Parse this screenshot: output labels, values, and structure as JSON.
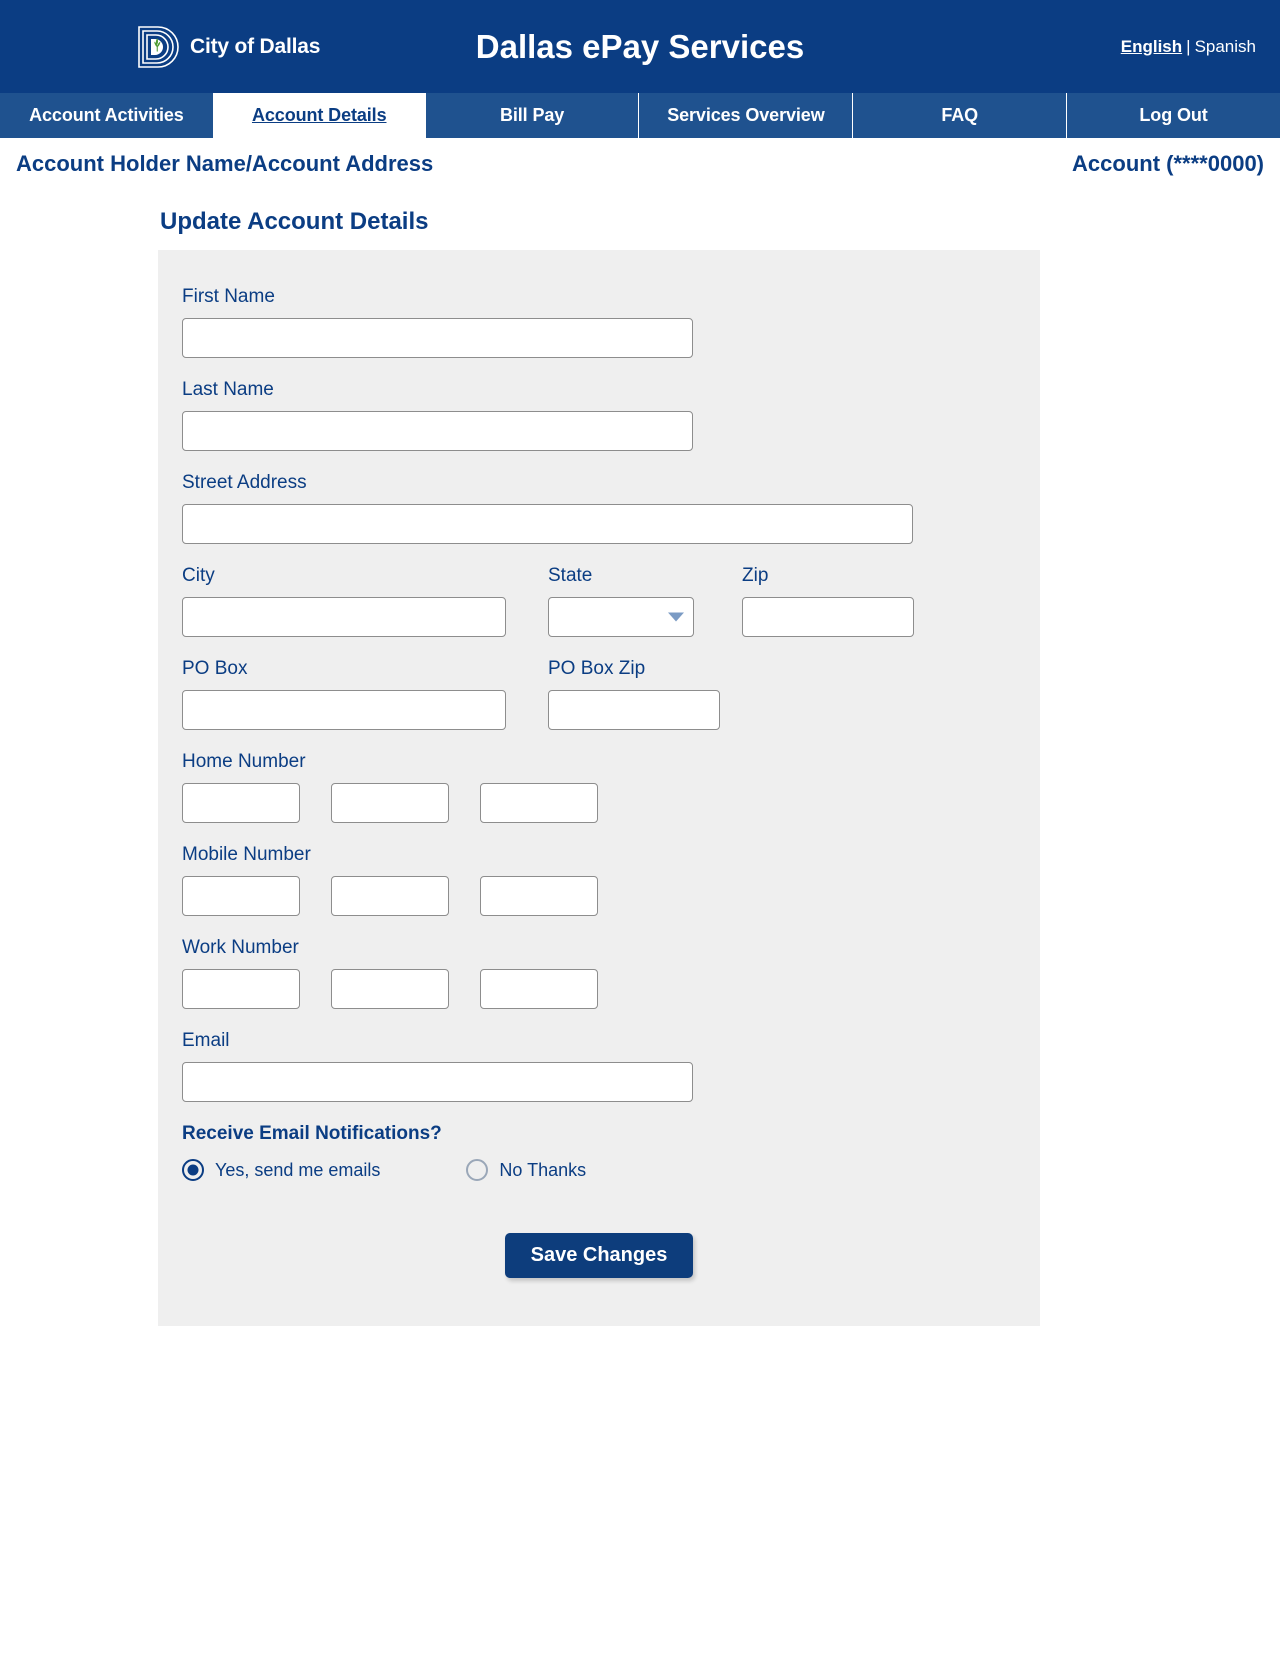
{
  "header": {
    "brand_name": "City of Dallas",
    "logo_icon": "city-of-dallas-logo",
    "app_title": "Dallas ePay Services",
    "language": {
      "active": "English",
      "separator": "|",
      "other": "Spanish"
    },
    "colors": {
      "header_bg": "#0b3d83",
      "nav_bg": "#1f528f",
      "accent_text": "#0b3d83",
      "panel_bg": "#efefef",
      "button_bg": "#0d3d7c",
      "chevron": "#7b9bc4"
    }
  },
  "nav": {
    "tabs": [
      {
        "label": "Account Activities",
        "active": false
      },
      {
        "label": "Account Details",
        "active": true
      },
      {
        "label": "Bill Pay",
        "active": false
      },
      {
        "label": "Services Overview",
        "active": false
      },
      {
        "label": "FAQ",
        "active": false
      },
      {
        "label": "Log Out",
        "active": false
      }
    ]
  },
  "account_bar": {
    "holder": "Account Holder Name/Account Address",
    "account": "Account (****0000)"
  },
  "form": {
    "title": "Update Account Details",
    "first_name": {
      "label": "First Name",
      "value": "",
      "placeholder": ""
    },
    "last_name": {
      "label": "Last Name",
      "value": "",
      "placeholder": ""
    },
    "street_address": {
      "label": "Street Address",
      "value": "",
      "placeholder": ""
    },
    "city": {
      "label": "City",
      "value": "",
      "placeholder": ""
    },
    "state": {
      "label": "State",
      "value": "",
      "placeholder": "",
      "icon": "chevron-down-icon"
    },
    "zip": {
      "label": "Zip",
      "value": "",
      "placeholder": ""
    },
    "po_box": {
      "label": "PO Box",
      "value": "",
      "placeholder": ""
    },
    "po_box_zip": {
      "label": "PO Box Zip",
      "value": "",
      "placeholder": ""
    },
    "home_number": {
      "label": "Home Number",
      "parts": [
        {
          "value": "",
          "placeholder": ""
        },
        {
          "value": "",
          "placeholder": ""
        },
        {
          "value": "",
          "placeholder": ""
        }
      ]
    },
    "mobile_number": {
      "label": "Mobile Number",
      "parts": [
        {
          "value": "",
          "placeholder": ""
        },
        {
          "value": "",
          "placeholder": ""
        },
        {
          "value": "",
          "placeholder": ""
        }
      ]
    },
    "work_number": {
      "label": "Work Number",
      "parts": [
        {
          "value": "",
          "placeholder": ""
        },
        {
          "value": "",
          "placeholder": ""
        },
        {
          "value": "",
          "placeholder": ""
        }
      ]
    },
    "email": {
      "label": "Email",
      "value": "",
      "placeholder": ""
    },
    "notifications": {
      "label": "Receive Email Notifications?",
      "options": [
        {
          "label": "Yes, send me emails",
          "selected": true
        },
        {
          "label": "No Thanks",
          "selected": false
        }
      ]
    },
    "save_button": "Save Changes"
  }
}
